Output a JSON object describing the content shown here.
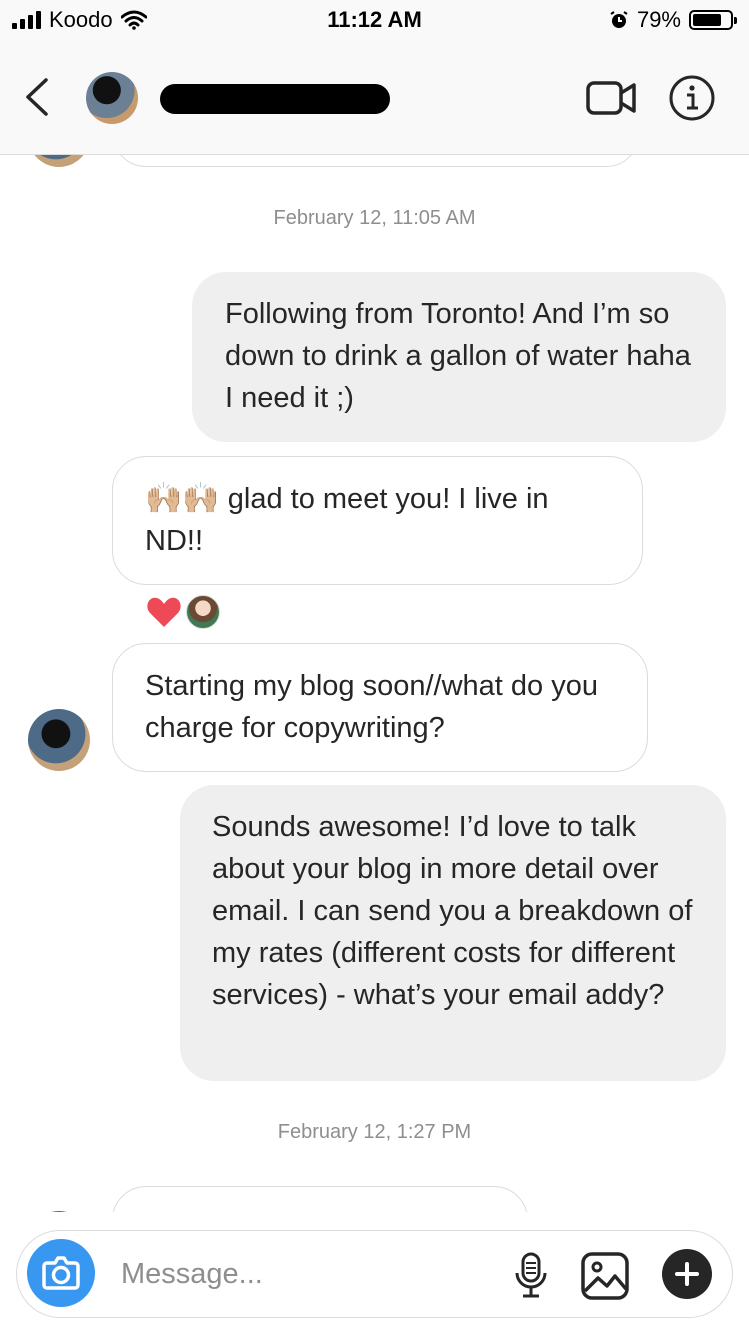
{
  "status_bar": {
    "carrier": "Koodo",
    "time": "11:12 AM",
    "battery": "79%",
    "battery_level": 0.79,
    "icons": [
      "signal-icon",
      "wifi-icon",
      "alarm-icon",
      "battery-icon"
    ]
  },
  "header": {
    "icons": [
      "back-chevron-icon",
      "video-camera-icon",
      "info-icon"
    ]
  },
  "chat": {
    "timestamps": [
      "February 12, 11:05 AM",
      "February 12, 1:27 PM"
    ],
    "messages": [
      {
        "direction": "outgoing",
        "text": "Following from Toronto! And I’m so down to drink a gallon of water haha I need it ;)"
      },
      {
        "direction": "incoming",
        "emoji": "🙌🏼🙌🏼",
        "text": " glad to meet you! I live in ND!!"
      },
      {
        "direction": "incoming",
        "text": "Starting  my blog soon//what do you charge for copywriting?"
      },
      {
        "direction": "outgoing",
        "text": "Sounds awesome! I’d love to talk about your blog in more detail over email. I can send you a breakdown of my rates (different costs for different services) - what’s your email addy?"
      }
    ],
    "reactions": [
      "heart-icon"
    ]
  },
  "composer": {
    "placeholder": "Message...",
    "icons": [
      "camera-icon",
      "microphone-icon",
      "gallery-icon",
      "plus-icon"
    ]
  },
  "colors": {
    "outgoing_bubble": "#efefef",
    "incoming_border": "#dbdbdb",
    "camera_button": "#3897f0",
    "heart": "#ed4956",
    "timestamp": "#8e8e8e"
  }
}
